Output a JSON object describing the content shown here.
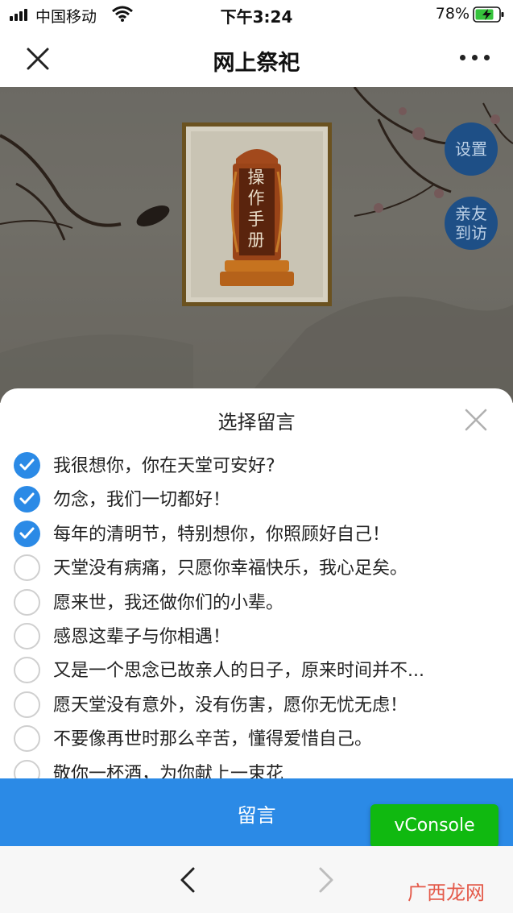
{
  "status_bar": {
    "carrier": "中国移动",
    "time": "下午3:24",
    "battery": "78%"
  },
  "nav": {
    "title": "网上祭祀"
  },
  "scene": {
    "tablet_text": "操作手册",
    "buttons": {
      "settings": "设置",
      "visit_line1": "亲友",
      "visit_line2": "到访"
    }
  },
  "sheet": {
    "title": "选择留言",
    "messages": [
      {
        "text": "我很想你，你在天堂可安好?",
        "checked": true
      },
      {
        "text": "勿念，我们一切都好！",
        "checked": true
      },
      {
        "text": "每年的清明节，特别想你，你照顾好自己！",
        "checked": true
      },
      {
        "text": "天堂没有病痛，只愿你幸福快乐，我心足矣。",
        "checked": false
      },
      {
        "text": "愿来世，我还做你们的小辈。",
        "checked": false
      },
      {
        "text": "感恩这辈子与你相遇！",
        "checked": false
      },
      {
        "text": "又是一个思念已故亲人的日子，原来时间并不...",
        "checked": false
      },
      {
        "text": "愿天堂没有意外，没有伤害，愿你无忧无虑！",
        "checked": false
      },
      {
        "text": "不要像再世时那么辛苦，懂得爱惜自己。",
        "checked": false
      },
      {
        "text": "敬你一杯酒，为你献上一束花",
        "checked": false
      }
    ]
  },
  "submit": {
    "label": "留言"
  },
  "vconsole": {
    "label": "vConsole"
  },
  "watermark": "广西龙网",
  "colors": {
    "accent": "#2b8ae6",
    "fab": "#1e4f86",
    "vconsole": "#10b910"
  }
}
